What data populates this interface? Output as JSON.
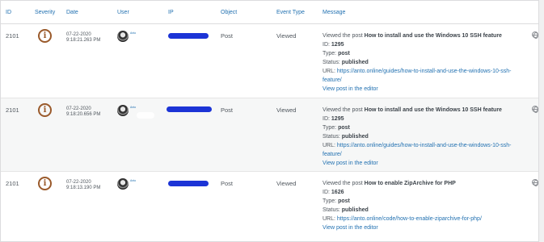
{
  "columns": [
    "ID",
    "Severity",
    "Date",
    "User",
    "IP",
    "Object",
    "Event Type",
    "Message"
  ],
  "rows": [
    {
      "id": "2101",
      "severity_icon": "info-icon",
      "date": "07-22-2020",
      "time": "9:18:21.263 PM",
      "user": "Anto",
      "object": "Post",
      "event_type": "Viewed",
      "message": {
        "intro": "Viewed the post",
        "post_title": "How to install and use the Windows 10 SSH feature",
        "id_label": "ID:",
        "id_value": "1295",
        "type_label": "Type:",
        "type_value": "post",
        "status_label": "Status:",
        "status_value": "published",
        "url_label": "URL:",
        "url_line1": "https://anto.online/guides/how-to-install-and-use-the-windows-10-ssh-",
        "url_line2": "feature/",
        "editor_link": "View post in the editor"
      }
    },
    {
      "id": "2101",
      "severity_icon": "info-icon",
      "date": "07-22-2020",
      "time": "9:18:20.656 PM",
      "user": "Anto",
      "object": "Post",
      "event_type": "Viewed",
      "message": {
        "intro": "Viewed the post",
        "post_title": "How to install and use the Windows 10 SSH feature",
        "id_label": "ID:",
        "id_value": "1295",
        "type_label": "Type:",
        "type_value": "post",
        "status_label": "Status:",
        "status_value": "published",
        "url_label": "URL:",
        "url_line1": "https://anto.online/guides/how-to-install-and-use-the-windows-10-ssh-",
        "url_line2": "feature/",
        "editor_link": "View post in the editor"
      }
    },
    {
      "id": "2101",
      "severity_icon": "info-icon",
      "date": "07-22-2020",
      "time": "9:18:13.190 PM",
      "user": "Anto",
      "object": "Post",
      "event_type": "Viewed",
      "message": {
        "intro": "Viewed the post",
        "post_title": "How to enable ZipArchive for PHP",
        "id_label": "ID:",
        "id_value": "1626",
        "type_label": "Type:",
        "type_value": "post",
        "status_label": "Status:",
        "status_value": "published",
        "url_label": "URL:",
        "url_line1": "https://anto.online/code/how-to-enable-ziparchive-for-php/",
        "url_line2": "",
        "editor_link": "View post in the editor"
      }
    }
  ],
  "colors": {
    "link": "#2271b1",
    "severity_info": "#9a5a2b",
    "ip_redaction": "#1c34d6",
    "row_alt": "#f6f7f7"
  }
}
